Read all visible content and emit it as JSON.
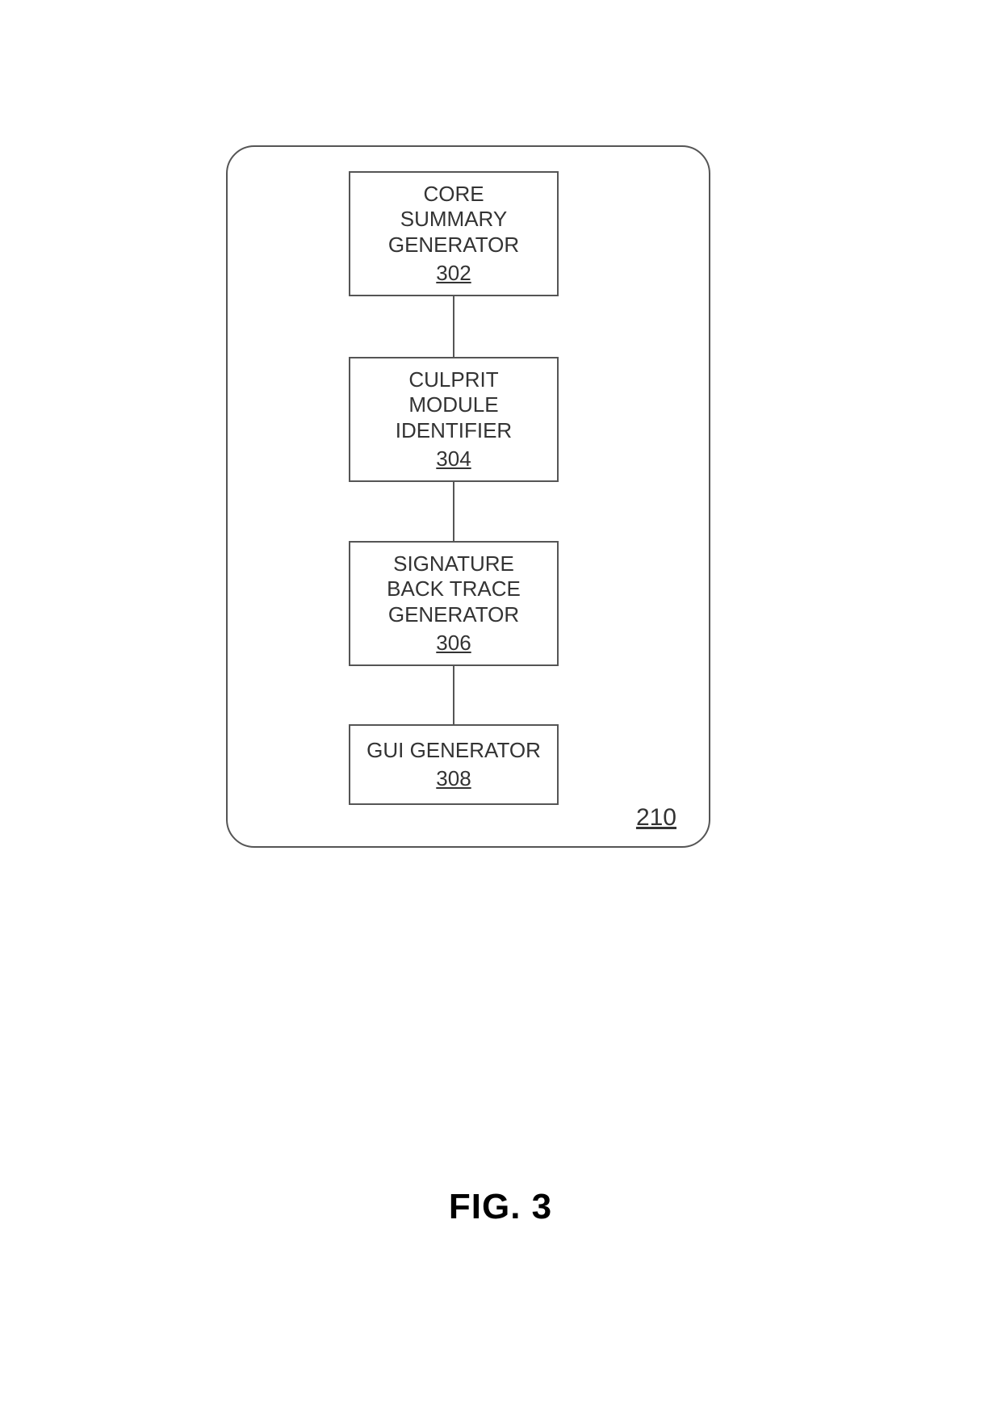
{
  "figure": {
    "label": "FIG. 3"
  },
  "container": {
    "reference_number": "210"
  },
  "boxes": {
    "box1": {
      "line1": "CORE",
      "line2": "SUMMARY",
      "line3": "GENERATOR",
      "number": "302"
    },
    "box2": {
      "line1": "CULPRIT",
      "line2": "MODULE",
      "line3": "IDENTIFIER",
      "number": "304"
    },
    "box3": {
      "line1": "SIGNATURE",
      "line2": "BACK TRACE",
      "line3": "GENERATOR",
      "number": "306"
    },
    "box4": {
      "line1": "GUI GENERATOR",
      "number": "308"
    }
  }
}
